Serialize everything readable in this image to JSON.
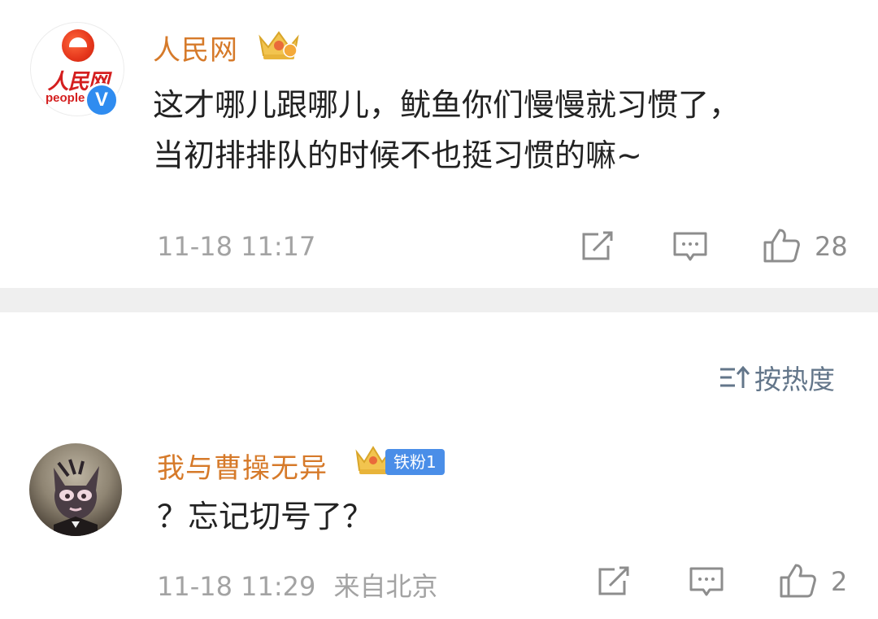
{
  "post": {
    "author": "人民网",
    "avatar_text": "人民网",
    "avatar_brand": "people",
    "verified_mark": "V",
    "content_line1": "这才哪儿跟哪儿，鱿鱼你们慢慢就习惯了，",
    "content_line2": "当初排排队的时候不也挺习惯的嘛~",
    "timestamp": "11-18 11:17",
    "like_count": "28",
    "icons": [
      "crown-badge-icon",
      "share-icon",
      "comment-icon",
      "like-icon"
    ]
  },
  "sort": {
    "icon": "sort-icon",
    "label": "按热度"
  },
  "comment": {
    "author": "我与曹操无异",
    "fan_badge": "铁粉1",
    "content": "？忘记切号了？",
    "timestamp": "11-18 11:29",
    "location": "来自北京",
    "like_count": "2",
    "icons": [
      "crown-badge-icon",
      "share-icon",
      "comment-icon",
      "like-icon"
    ]
  },
  "colors": {
    "name": "#d67a2a",
    "verified_blue": "#2f8cf0",
    "fan_badge_blue": "#4a8ee8",
    "meta_gray": "#a3a3a3",
    "separator": "#efefef"
  }
}
